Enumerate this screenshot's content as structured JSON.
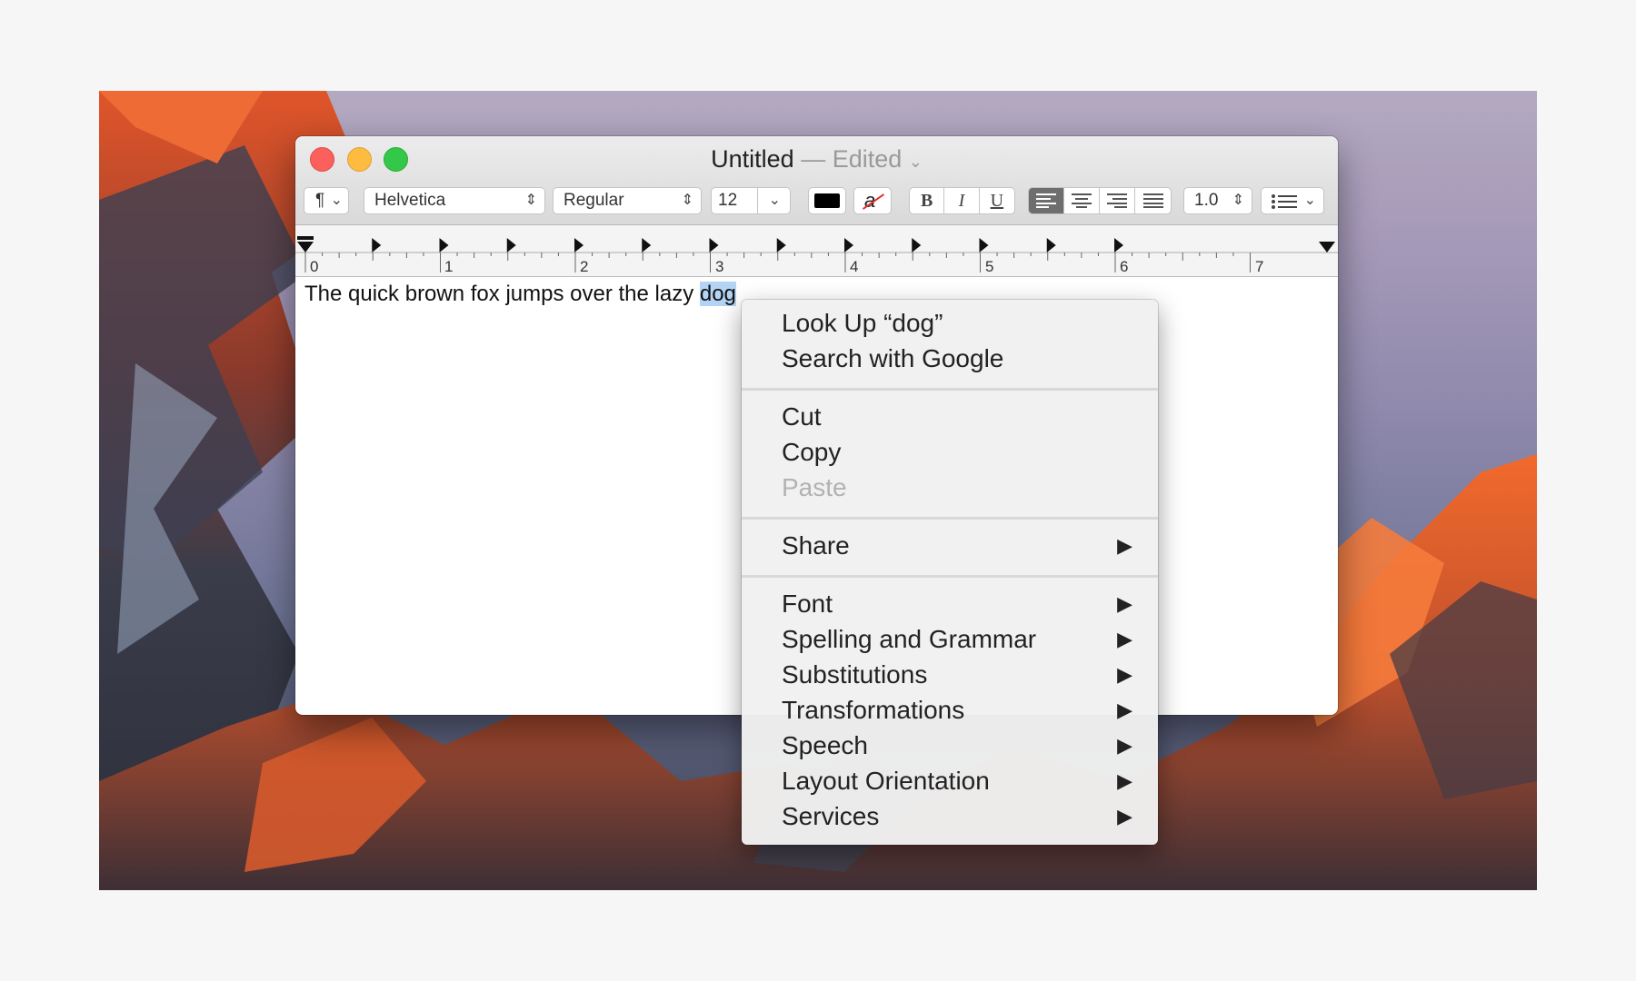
{
  "window": {
    "title": "Untitled",
    "title_separator": "—",
    "status": "Edited"
  },
  "toolbar": {
    "paragraph_style": "¶",
    "font_family": "Helvetica",
    "font_style": "Regular",
    "font_size": "12",
    "bold": "B",
    "italic": "I",
    "underline": "U",
    "highlight_glyph": "a",
    "line_spacing": "1.0",
    "text_color": "#000000",
    "active_alignment": "left"
  },
  "ruler": {
    "numbers": [
      "0",
      "1",
      "2",
      "3",
      "4",
      "5",
      "6",
      "7"
    ]
  },
  "document": {
    "text_before": "The quick brown fox jumps over the lazy ",
    "selected_text": "dog"
  },
  "context_menu": {
    "lookup": "Look Up “dog”",
    "search": "Search with Google",
    "cut": "Cut",
    "copy": "Copy",
    "paste": "Paste",
    "share": "Share",
    "font": "Font",
    "spelling": "Spelling and Grammar",
    "substitutions": "Substitutions",
    "transformations": "Transformations",
    "speech": "Speech",
    "layout": "Layout Orientation",
    "services": "Services",
    "submenu_arrow": "▶"
  }
}
